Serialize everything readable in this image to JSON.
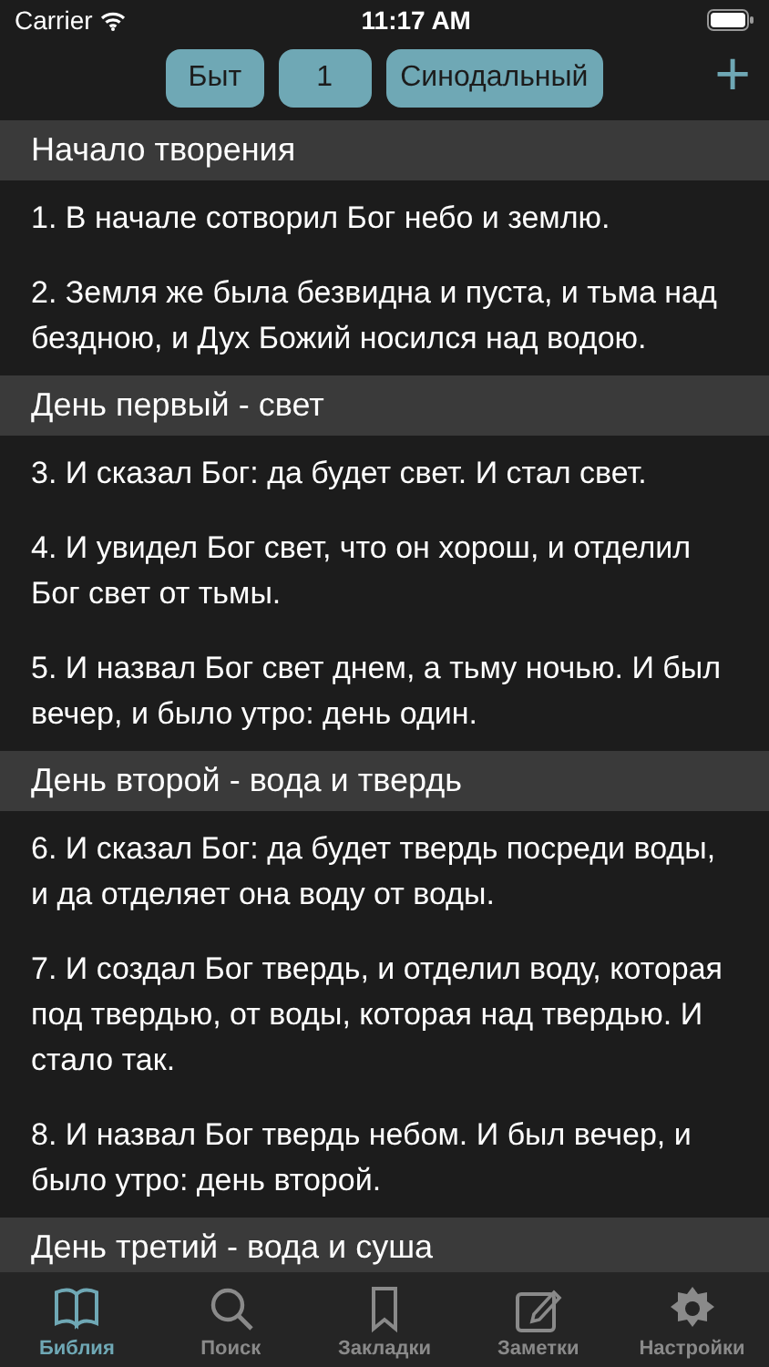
{
  "status_bar": {
    "carrier": "Carrier",
    "time": "11:17 AM"
  },
  "toolbar": {
    "book": "Быт",
    "chapter": "1",
    "translation": "Синодальный",
    "add": "+"
  },
  "sections": [
    {
      "title": "Начало творения",
      "verses": [
        "1. В начале сотворил Бог небо и землю.",
        "2. Земля же была безвидна и пуста, и тьма над бездною, и Дух Божий носился над водою."
      ]
    },
    {
      "title": "День первый - свет",
      "verses": [
        "3. И сказал Бог: да будет свет. И стал свет.",
        "4. И увидел Бог свет, что он хорош, и отделил Бог свет от тьмы.",
        "5. И назвал Бог свет днем, а тьму ночью. И был вечер, и было утро: день один."
      ]
    },
    {
      "title": "День второй - вода и твердь",
      "verses": [
        "6. И сказал Бог: да будет твердь посреди воды, и да отделяет она воду от воды.",
        "7. И создал Бог твердь, и отделил воду, которая под твердью, от воды, которая над твердью. И стало так.",
        "8. И назвал Бог твердь небом. И был вечер, и было утро: день второй."
      ]
    },
    {
      "title": "День третий - вода и суша"
    }
  ],
  "tabs": [
    {
      "label": "Библия",
      "kind": "book",
      "selected": true
    },
    {
      "label": "Поиск",
      "kind": "search",
      "selected": false
    },
    {
      "label": "Закладки",
      "kind": "bookmark",
      "selected": false
    },
    {
      "label": "Заметки",
      "kind": "note",
      "selected": false
    },
    {
      "label": "Настройки",
      "kind": "settings",
      "selected": false
    }
  ]
}
